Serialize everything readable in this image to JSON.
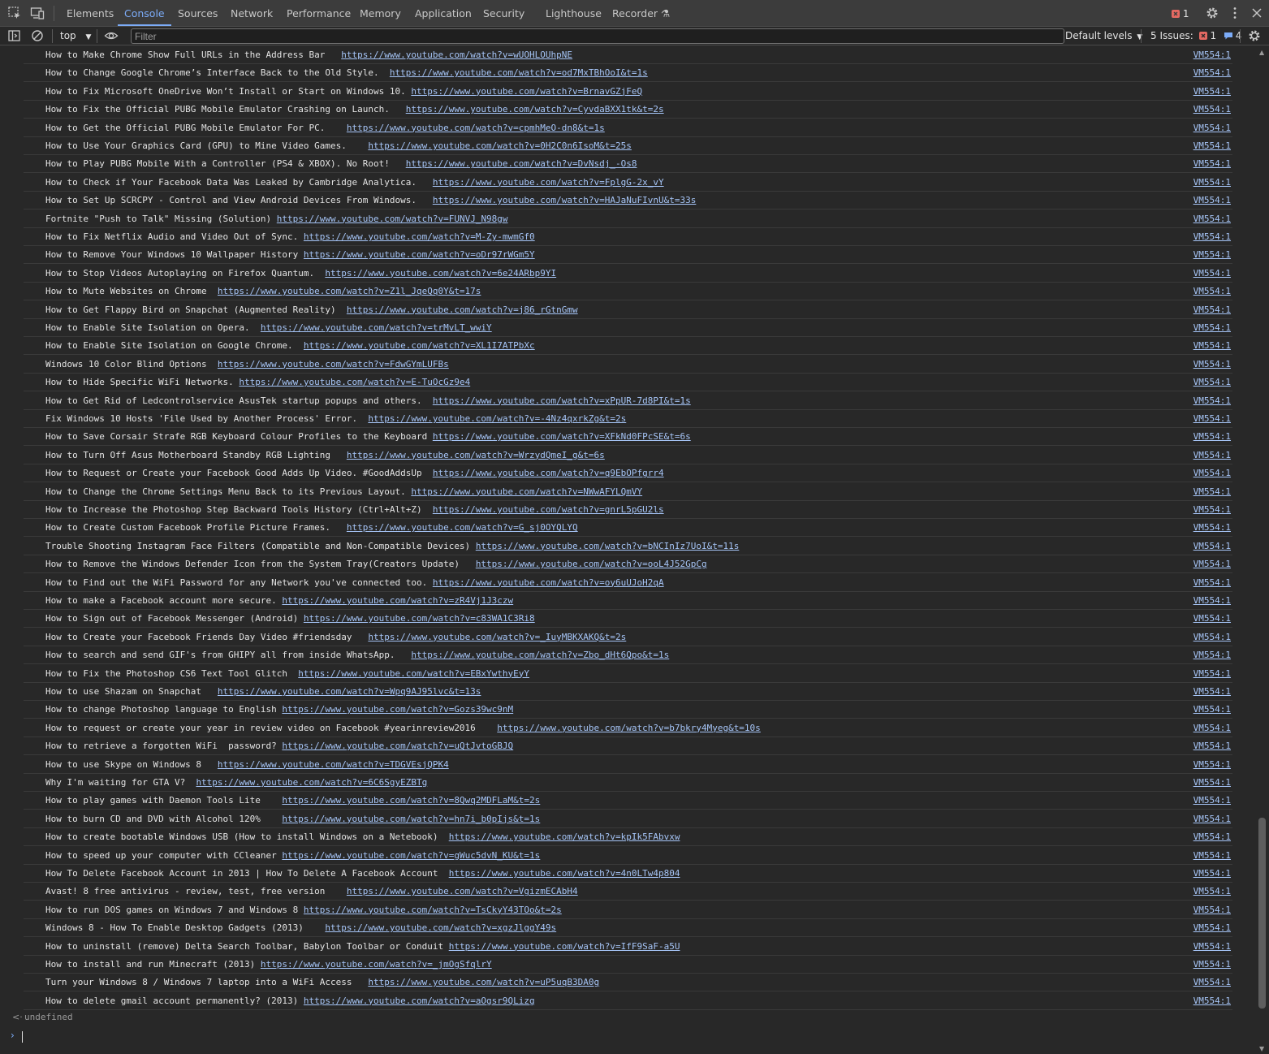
{
  "tabs": [
    "Elements",
    "Console",
    "Sources",
    "Network",
    "Performance",
    "Memory",
    "Application",
    "Security",
    "Lighthouse",
    "Recorder"
  ],
  "active_tab": "Console",
  "error_count": "1",
  "toolbar": {
    "context": "top",
    "filter_placeholder": "Filter",
    "levels": "Default levels",
    "issues_label": "5 Issues:",
    "issues_errors": "1",
    "issues_info": "4"
  },
  "source_link": "VM554:1",
  "entries": [
    {
      "title": "How to Make Chrome Show Full URLs in the Address Bar   ",
      "url": "https://www.youtube.com/watch?v=wUOHLOUhpNE"
    },
    {
      "title": "How to Change Google Chrome’s Interface Back to the Old Style.  ",
      "url": "https://www.youtube.com/watch?v=od7MxTBhOoI&t=1s"
    },
    {
      "title": "How to Fix Microsoft OneDrive Won’t Install or Start on Windows 10. ",
      "url": "https://www.youtube.com/watch?v=BrnavGZjFeQ"
    },
    {
      "title": "How to Fix the Official PUBG Mobile Emulator Crashing on Launch.   ",
      "url": "https://www.youtube.com/watch?v=CyvdaBXX1tk&t=2s"
    },
    {
      "title": "How to Get the Official PUBG Mobile Emulator For PC.    ",
      "url": "https://www.youtube.com/watch?v=cpmhMeO-dn8&t=1s"
    },
    {
      "title": "How to Use Your Graphics Card (GPU) to Mine Video Games.    ",
      "url": "https://www.youtube.com/watch?v=0H2C0n6IsoM&t=25s"
    },
    {
      "title": "How to Play PUBG Mobile With a Controller (PS4 & XBOX). No Root!   ",
      "url": "https://www.youtube.com/watch?v=DvNsdj_-Os8"
    },
    {
      "title": "How to Check if Your Facebook Data Was Leaked by Cambridge Analytica.   ",
      "url": "https://www.youtube.com/watch?v=FplgG-2x_vY"
    },
    {
      "title": "How to Set Up SCRCPY - Control and View Android Devices From Windows.   ",
      "url": "https://www.youtube.com/watch?v=HAJaNuFIvnU&t=33s"
    },
    {
      "title": "Fortnite \"Push to Talk\" Missing (Solution) ",
      "url": "https://www.youtube.com/watch?v=FUNVJ_N98gw"
    },
    {
      "title": "How to Fix Netflix Audio and Video Out of Sync. ",
      "url": "https://www.youtube.com/watch?v=M-Zy-mwmGf0"
    },
    {
      "title": "How to Remove Your Windows 10 Wallpaper History ",
      "url": "https://www.youtube.com/watch?v=oDr97rWGm5Y"
    },
    {
      "title": "How to Stop Videos Autoplaying on Firefox Quantum.  ",
      "url": "https://www.youtube.com/watch?v=6e24ARbp9YI"
    },
    {
      "title": "How to Mute Websites on Chrome  ",
      "url": "https://www.youtube.com/watch?v=Z1l_JqeQq0Y&t=17s"
    },
    {
      "title": "How to Get Flappy Bird on Snapchat (Augmented Reality)  ",
      "url": "https://www.youtube.com/watch?v=j86_rGtnGmw"
    },
    {
      "title": "How to Enable Site Isolation on Opera.  ",
      "url": "https://www.youtube.com/watch?v=trMvLT_wwiY"
    },
    {
      "title": "How to Enable Site Isolation on Google Chrome.  ",
      "url": "https://www.youtube.com/watch?v=XL1I7ATPbXc"
    },
    {
      "title": "Windows 10 Color Blind Options  ",
      "url": "https://www.youtube.com/watch?v=FdwGYmLUFBs"
    },
    {
      "title": "How to Hide Specific WiFi Networks. ",
      "url": "https://www.youtube.com/watch?v=E-TuOcGz9e4"
    },
    {
      "title": "How to Get Rid of Ledcontrolservice AsusTek startup popups and others.  ",
      "url": "https://www.youtube.com/watch?v=xPpUR-7d8PI&t=1s"
    },
    {
      "title": "Fix Windows 10 Hosts 'File Used by Another Process' Error.  ",
      "url": "https://www.youtube.com/watch?v=-4Nz4qxrkZg&t=2s"
    },
    {
      "title": "How to Save Corsair Strafe RGB Keyboard Colour Profiles to the Keyboard ",
      "url": "https://www.youtube.com/watch?v=XFkNd0FPcSE&t=6s"
    },
    {
      "title": "How to Turn Off Asus Motherboard Standby RGB Lighting   ",
      "url": "https://www.youtube.com/watch?v=WrzydQmeI_g&t=6s"
    },
    {
      "title": "How to Request or Create your Facebook Good Adds Up Video. #GoodAddsUp  ",
      "url": "https://www.youtube.com/watch?v=q9EbOPfgrr4"
    },
    {
      "title": "How to Change the Chrome Settings Menu Back to its Previous Layout. ",
      "url": "https://www.youtube.com/watch?v=NWwAFYLQmVY"
    },
    {
      "title": "How to Increase the Photoshop Step Backward Tools History (Ctrl+Alt+Z)  ",
      "url": "https://www.youtube.com/watch?v=gnrL5pGU2ls"
    },
    {
      "title": "How to Create Custom Facebook Profile Picture Frames.   ",
      "url": "https://www.youtube.com/watch?v=G_sj0OYQLYQ"
    },
    {
      "title": "Trouble Shooting Instagram Face Filters (Compatible and Non-Compatible Devices) ",
      "url": "https://www.youtube.com/watch?v=bNCInIz7UoI&t=11s"
    },
    {
      "title": "How to Remove the Windows Defender Icon from the System Tray(Creators Update)   ",
      "url": "https://www.youtube.com/watch?v=ooL4J52GpCg"
    },
    {
      "title": "How to Find out the WiFi Password for any Network you've connected too. ",
      "url": "https://www.youtube.com/watch?v=oy6uUJoH2qA"
    },
    {
      "title": "How to make a Facebook account more secure. ",
      "url": "https://www.youtube.com/watch?v=zR4Vj1J3czw"
    },
    {
      "title": "How to Sign out of Facebook Messenger (Android) ",
      "url": "https://www.youtube.com/watch?v=c83WA1C3Ri8"
    },
    {
      "title": "How to Create your Facebook Friends Day Video #friendsday   ",
      "url": "https://www.youtube.com/watch?v=_IuyMBKXAKQ&t=2s"
    },
    {
      "title": "How to search and send GIF's from GHIPY all from inside WhatsApp.   ",
      "url": "https://www.youtube.com/watch?v=Zbo_dHt6Qpo&t=1s"
    },
    {
      "title": "How to Fix the Photoshop CS6 Text Tool Glitch  ",
      "url": "https://www.youtube.com/watch?v=EBxYwthyEyY"
    },
    {
      "title": "How to use Shazam on Snapchat   ",
      "url": "https://www.youtube.com/watch?v=Wpq9AJ95lvc&t=13s"
    },
    {
      "title": "How to change Photoshop language to English ",
      "url": "https://www.youtube.com/watch?v=Gozs39wc9nM"
    },
    {
      "title": "How to request or create your year in review video on Facebook #yearinreview2016    ",
      "url": "https://www.youtube.com/watch?v=b7bkry4Myeg&t=10s"
    },
    {
      "title": "How to retrieve a forgotten WiFi  password? ",
      "url": "https://www.youtube.com/watch?v=uQtJvtoGBJQ"
    },
    {
      "title": "How to use Skype on Windows 8   ",
      "url": "https://www.youtube.com/watch?v=TDGVEsjQPK4"
    },
    {
      "title": "Why I'm waiting for GTA V?  ",
      "url": "https://www.youtube.com/watch?v=6C6SgyEZBTg"
    },
    {
      "title": "How to play games with Daemon Tools Lite    ",
      "url": "https://www.youtube.com/watch?v=8Qwq2MDFLaM&t=2s"
    },
    {
      "title": "How to burn CD and DVD with Alcohol 120%    ",
      "url": "https://www.youtube.com/watch?v=hn7i_b0pIjs&t=1s"
    },
    {
      "title": "How to create bootable Windows USB (How to install Windows on a Netebook)  ",
      "url": "https://www.youtube.com/watch?v=kpIk5FAbvxw"
    },
    {
      "title": "How to speed up your computer with CCleaner ",
      "url": "https://www.youtube.com/watch?v=gWuc5dvN_KU&t=1s"
    },
    {
      "title": "How To Delete Facebook Account in 2013 | How To Delete A Facebook Account  ",
      "url": "https://www.youtube.com/watch?v=4n0LTw4p804"
    },
    {
      "title": "Avast! 8 free antivirus - review, test, free version    ",
      "url": "https://www.youtube.com/watch?v=VgizmECAbH4"
    },
    {
      "title": "How to run DOS games on Windows 7 and Windows 8 ",
      "url": "https://www.youtube.com/watch?v=TsCkyY43TOo&t=2s"
    },
    {
      "title": "Windows 8 - How To Enable Desktop Gadgets (2013)    ",
      "url": "https://www.youtube.com/watch?v=xgzJlggY49s"
    },
    {
      "title": "How to uninstall (remove) Delta Search Toolbar, Babylon Toolbar or Conduit ",
      "url": "https://www.youtube.com/watch?v=IfF9SaF-a5U"
    },
    {
      "title": "How to install and run Minecraft (2013) ",
      "url": "https://www.youtube.com/watch?v=_jmOgSfqlrY"
    },
    {
      "title": "Turn your Windows 8 / Windows 7 laptop into a WiFi Access   ",
      "url": "https://www.youtube.com/watch?v=uP5uqB3DA0g"
    },
    {
      "title": "How to delete gmail account permanently? (2013) ",
      "url": "https://www.youtube.com/watch?v=aOgsr9QLizg"
    }
  ],
  "result_text": "undefined"
}
